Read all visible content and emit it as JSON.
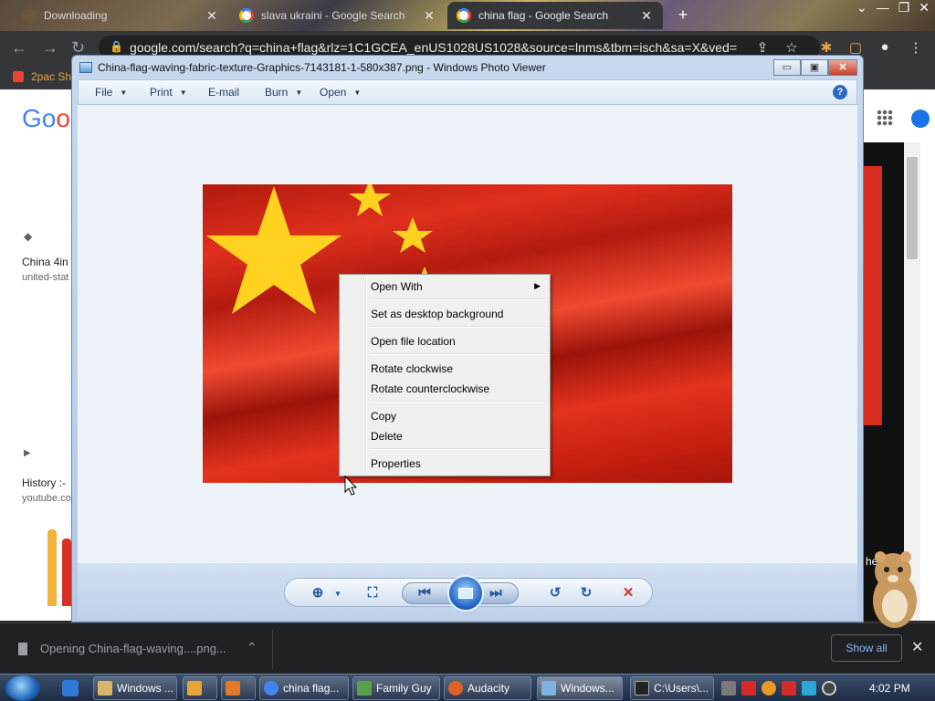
{
  "browser": {
    "tabs": [
      {
        "title": "Downloading",
        "active": false
      },
      {
        "title": "slava ukraini - Google Search",
        "active": false
      },
      {
        "title": "china flag - Google Search",
        "active": true
      }
    ],
    "url": "google.com/search?q=china+flag&rlz=1C1GCEA_enUS1028US1028&source=lnms&tbm=isch&sa=X&ved=",
    "bookmark": "2pac Sh"
  },
  "google": {
    "logo_part1": "Go",
    "logo_part2": "o",
    "result1_title": "China 4in",
    "result1_source": "united-stat",
    "result2_title": "History :-",
    "result2_source": "youtube.co",
    "side_text": "he"
  },
  "viewer": {
    "title": "China-flag-waving-fabric-texture-Graphics-7143181-1-580x387.png - Windows Photo Viewer",
    "caption": {
      "minimize": "▭",
      "maximize": "▣",
      "close": "✕"
    },
    "menus": [
      {
        "label": "File",
        "has_arrow": true
      },
      {
        "label": "Print",
        "has_arrow": true
      },
      {
        "label": "E-mail",
        "has_arrow": false
      },
      {
        "label": "Burn",
        "has_arrow": true
      },
      {
        "label": "Open",
        "has_arrow": true
      }
    ],
    "help": "?"
  },
  "context_menu": {
    "items": [
      {
        "label": "Open With",
        "submenu": true
      },
      {
        "label": "Set as desktop background"
      },
      {
        "label": "Open file location"
      },
      {
        "label": "Rotate clockwise"
      },
      {
        "label": "Rotate counterclockwise"
      },
      {
        "label": "Copy"
      },
      {
        "label": "Delete"
      },
      {
        "label": "Properties"
      }
    ]
  },
  "downloads": {
    "item": "Opening China-flag-waving....png...",
    "show_all": "Show all"
  },
  "taskbar": {
    "buttons": [
      {
        "label": "Windows ...",
        "color": "#d8b56a"
      },
      {
        "label": "",
        "color": "#e8a33b"
      },
      {
        "label": "",
        "color": "#e07a2b"
      },
      {
        "label": "china flag...",
        "color": "#4285f4"
      },
      {
        "label": "Family Guy",
        "color": "#58a04a"
      },
      {
        "label": "Audacity",
        "color": "#e0622b"
      },
      {
        "label": "Windows...",
        "color": "#7fb2e0"
      },
      {
        "label": "C:\\Users\\...",
        "color": "#222222"
      }
    ],
    "clock": "4:02 PM"
  },
  "colors": {
    "flag_red": "#d62b1e",
    "flag_yellow": "#ffd700",
    "viewer_frame": "#c6d9ef"
  }
}
